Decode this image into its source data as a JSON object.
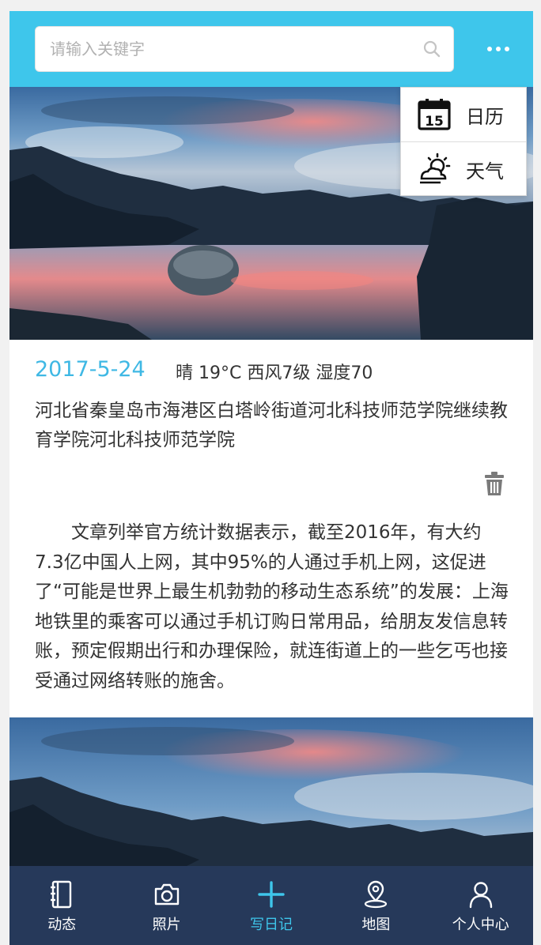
{
  "search": {
    "placeholder": "请输入关键字"
  },
  "menu": {
    "items": [
      {
        "label": "日历",
        "icon": "calendar-icon",
        "day": "15"
      },
      {
        "label": "天气",
        "icon": "weather-icon"
      }
    ]
  },
  "entry": {
    "date": "2017-5-24",
    "weather": "晴 19°C 西风7级 湿度70",
    "location": "河北省秦皇岛市海港区白塔岭街道河北科技师范学院继续教育学院河北科技师范学院",
    "body": "文章列举官方统计数据表示，截至2016年，有大约7.3亿中国人上网，其中95%的人通过手机上网，这促进了“可能是世界上最生机勃勃的移动生态系统”的发展：上海地铁里的乘客可以通过手机订购日常用品，给朋友发信息转账，预定假期出行和办理保险，就连街道上的一些乞丐也接受通过网络转账的施舍。"
  },
  "tabs": [
    {
      "label": "动态",
      "icon": "notebook-icon"
    },
    {
      "label": "照片",
      "icon": "camera-icon"
    },
    {
      "label": "写日记",
      "icon": "plus-icon",
      "active": true
    },
    {
      "label": "地图",
      "icon": "map-pin-icon"
    },
    {
      "label": "个人中心",
      "icon": "user-icon"
    }
  ],
  "colors": {
    "header": "#3ec6eb",
    "accent": "#3fb8e4",
    "tabbar": "#26395a"
  }
}
